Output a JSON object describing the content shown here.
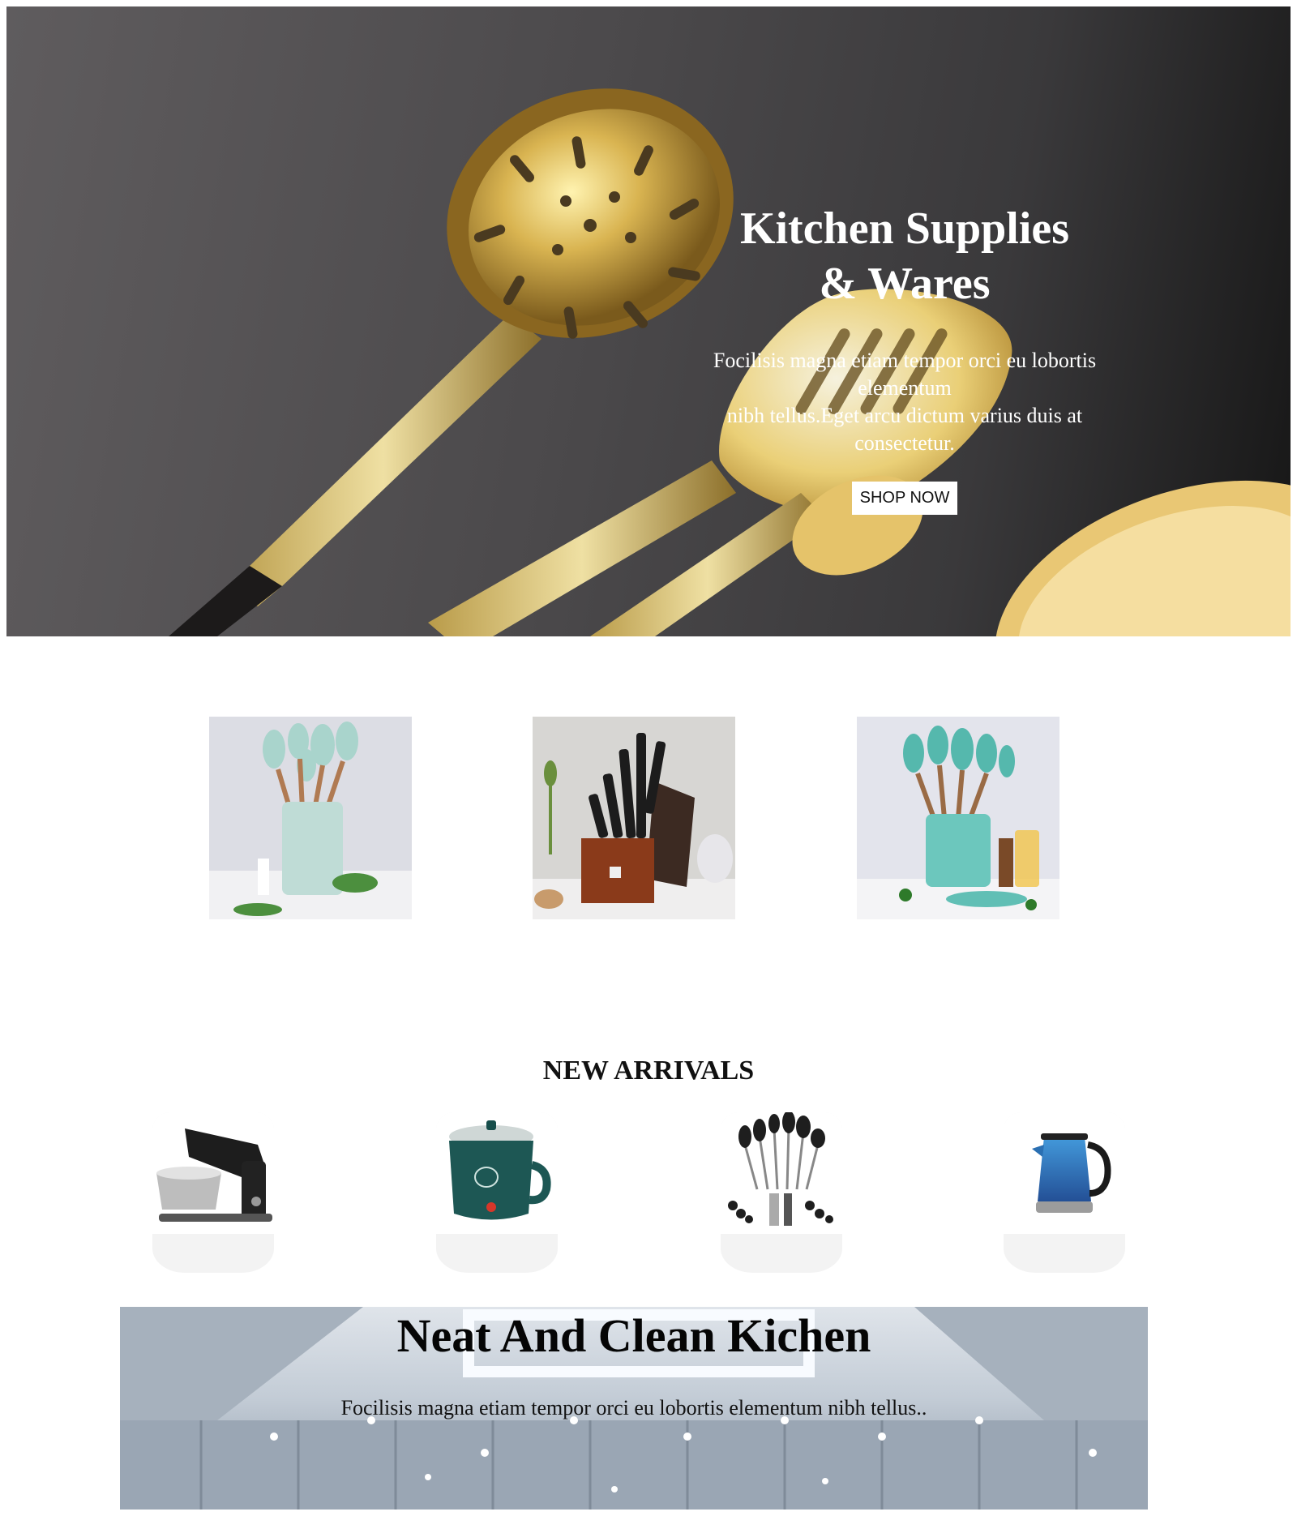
{
  "hero": {
    "title": "Kitchen Supplies\n& Wares",
    "description": "Focilisis magna etiam tempor orci eu lobortis elementum\nnibh tellus.Eget arcu dictum varius duis at consectetur.",
    "cta_label": "SHOP NOW",
    "image_icon": "golden-utensils-photo"
  },
  "categories": {
    "items": [
      {
        "icon": "mint-silicone-utensil-set-photo"
      },
      {
        "icon": "knife-block-set-photo"
      },
      {
        "icon": "teal-utensil-holder-photo"
      }
    ]
  },
  "new_arrivals": {
    "title": "NEW ARRIVALS",
    "products": [
      {
        "icon": "stand-mixer-photo"
      },
      {
        "icon": "electric-cooking-pot-photo"
      },
      {
        "icon": "utensil-tool-set-photo"
      },
      {
        "icon": "glass-electric-kettle-photo"
      }
    ]
  },
  "banner": {
    "title": "Neat And Clean Kichen",
    "description": "Focilisis magna etiam tempor orci eu lobortis elementum nibh tellus..",
    "image_icon": "kitchen-ceiling-photo"
  },
  "colors": {
    "hero_overlay_text": "#ffffff",
    "button_bg": "#ffffff",
    "card_bg": "#f3f3f3",
    "gold": "#c9a640",
    "teal": "#5fb9b1"
  }
}
